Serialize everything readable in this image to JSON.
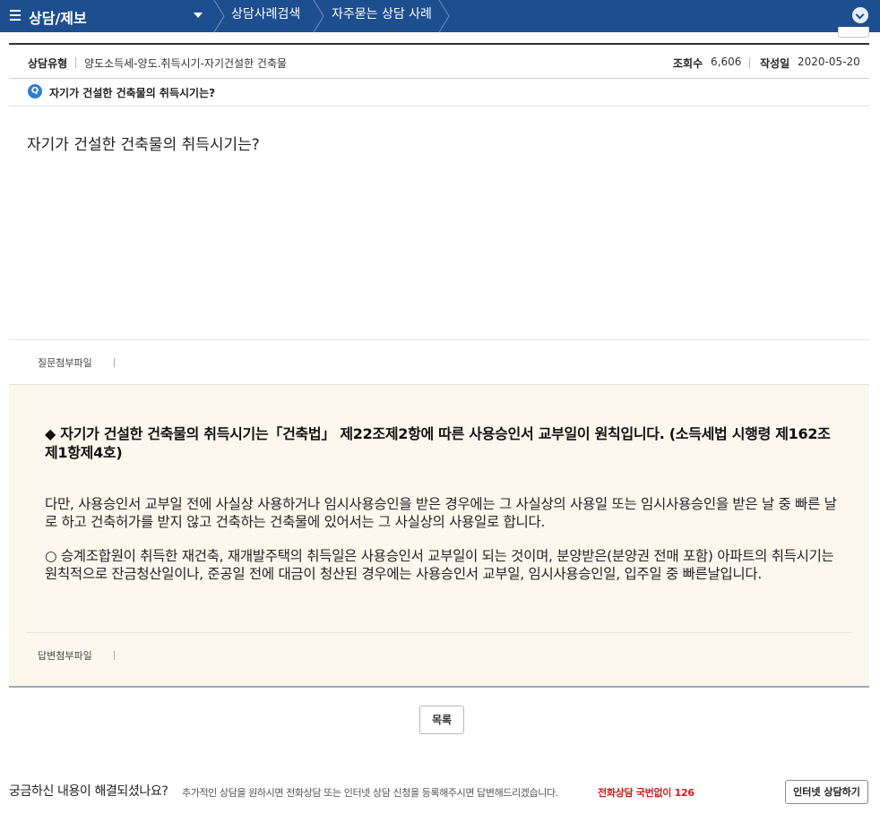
{
  "nav": {
    "menu_title": "상담/제보",
    "breadcrumbs": [
      "상담사례검색",
      "자주묻는 상담 사례"
    ],
    "colors": {
      "nav_bg": "#1d4e8f"
    },
    "icons": {
      "menu": "hamburger-icon",
      "dropdown": "caret-down-icon",
      "toggle": "chevron-down-icon"
    }
  },
  "meta": {
    "type_label": "상담유형",
    "type_value": "양도소득세-양도.취득시기-자기건설한 건축물",
    "views_label": "조회수",
    "views_value": "6,606",
    "date_label": "작성일",
    "date_value": "2020-05-20"
  },
  "question": {
    "badge": "Q",
    "title": "자기가 건설한 건축물의 취득시기는?",
    "body": "자기가 건설한 건축물의 취득시기는?",
    "attachment_label": "질문첨부파일"
  },
  "answer": {
    "headline": "◆ 자기가 건설한 건축물의 취득시기는「건축법」 제22조제2항에 따른 사용승인서 교부일이 원칙입니다. (소득세법 시행령 제162조 제1항제4호)",
    "paragraph_1": "다만, 사용승인서 교부일 전에 사실상 사용하거나 임시사용승인을 받은 경우에는 그 사실상의 사용일 또는 임시사용승인을 받은 날 중 빠른 날로 하고 건축허가를 받지 않고 건축하는 건축물에 있어서는 그 사실상의 사용일로 합니다.",
    "paragraph_2": "○ 승계조합원이 취득한 재건축, 재개발주택의 취득일은 사용승인서 교부일이 되는 것이며, 분양받은(분양권 전매 포함) 아파트의 취득시기는 원칙적으로 잔금청산일이나, 준공일 전에 대금이 청산된 경우에는 사용승인서 교부일, 임시사용승인일, 입주일 중 빠른날입니다.",
    "attachment_label": "답변첨부파일",
    "colors": {
      "bg": "#fcf8ee"
    }
  },
  "actions": {
    "list_button": "목록"
  },
  "footer": {
    "question": "궁금하신 내용이 해결되셨나요?",
    "description": "추가적인 상담을 원하시면 전화상담 또는 인터넷 상담 신청을 등록해주시면 답변해드리겠습니다.",
    "phone": "전화상담 국번없이 126",
    "consult_button": "인터넷 상담하기",
    "colors": {
      "phone": "#cc1b1b"
    }
  }
}
